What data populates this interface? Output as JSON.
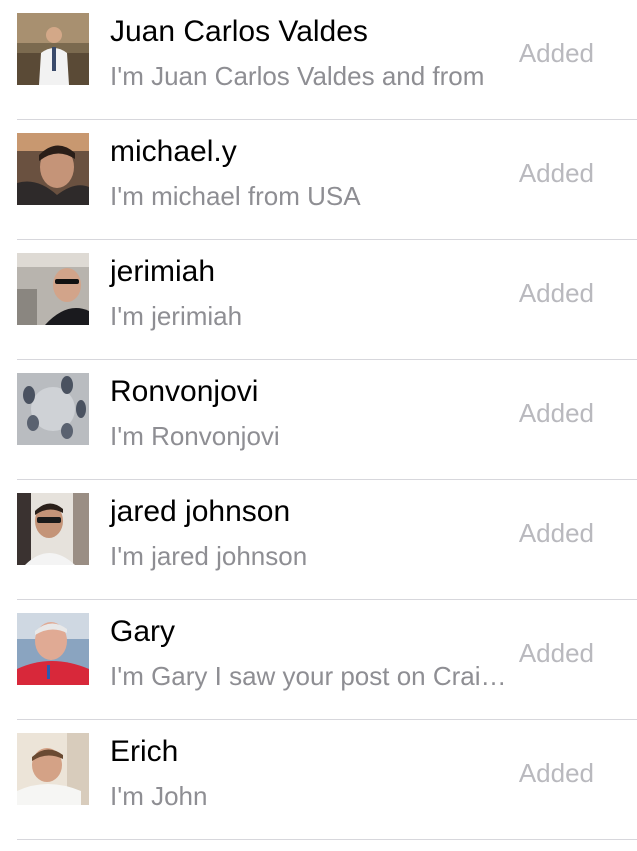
{
  "status_label": "Added",
  "contacts": [
    {
      "name": "Juan Carlos Valdes",
      "subtitle": "I'm Juan Carlos Valdes and from"
    },
    {
      "name": "michael.y",
      "subtitle": "I'm michael from USA"
    },
    {
      "name": "jerimiah",
      "subtitle": "I'm jerimiah"
    },
    {
      "name": "Ronvonjovi",
      "subtitle": "I'm Ronvonjovi"
    },
    {
      "name": "jared johnson",
      "subtitle": "I'm jared johnson"
    },
    {
      "name": "Gary",
      "subtitle": "I'm Gary I saw your post on Craigslist"
    },
    {
      "name": "Erich",
      "subtitle": "I'm John"
    }
  ],
  "colors": {
    "name": "#000000",
    "subtitle": "#8e8e93",
    "status": "#b9b9be",
    "divider": "#d7d7dc"
  }
}
